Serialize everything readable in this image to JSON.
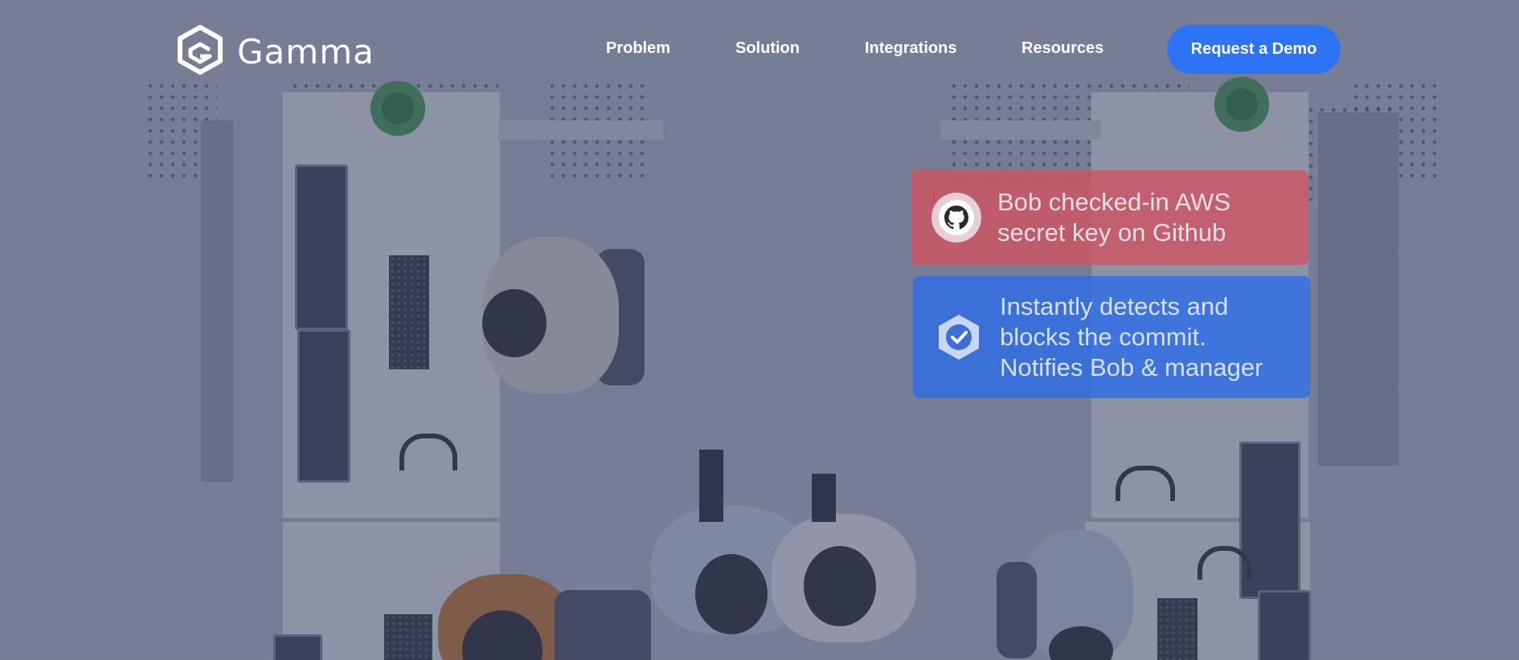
{
  "brand": {
    "name": "Gamma",
    "logo_icon": "gamma-hexagon-logo"
  },
  "nav": {
    "links": [
      "Problem",
      "Solution",
      "Integrations",
      "Resources"
    ],
    "cta_label": "Request a Demo"
  },
  "cards": {
    "alert": {
      "icon": "github-alert-icon",
      "badge": "!",
      "lines": [
        "Bob checked-in AWS",
        "secret key on Github"
      ]
    },
    "success": {
      "icon": "shield-check-icon",
      "lines": [
        "Instantly detects and",
        "blocks the commit.",
        "Notifies Bob & manager"
      ]
    }
  },
  "colors": {
    "cta": "#2d73f5",
    "alert_card": "#d15462",
    "success_card": "#2d6ee6",
    "overlay": "#3a4262"
  }
}
